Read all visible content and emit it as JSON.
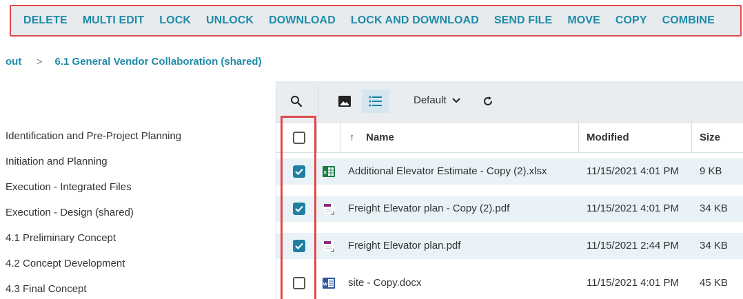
{
  "toolbar": {
    "actions": [
      "DELETE",
      "MULTI EDIT",
      "LOCK",
      "UNLOCK",
      "DOWNLOAD",
      "LOCK AND DOWNLOAD",
      "SEND FILE",
      "MOVE",
      "COPY",
      "COMBINE"
    ]
  },
  "breadcrumb": {
    "previous": "out",
    "separator": ">",
    "current": "6.1 General Vendor Collaboration (shared)"
  },
  "tree": {
    "items": [
      "Identification and Pre-Project Planning",
      "Initiation and Planning",
      "Execution - Integrated Files",
      "Execution - Design (shared)",
      "4.1 Preliminary Concept",
      "4.2 Concept Development",
      "4.3 Final Concept"
    ]
  },
  "file_toolbar": {
    "view_mode": "Default",
    "icons": [
      "search-icon",
      "image-view-icon",
      "list-view-icon",
      "chevron-down-icon",
      "refresh-icon"
    ]
  },
  "table": {
    "columns": {
      "name": "Name",
      "modified": "Modified",
      "size": "Size"
    },
    "sort_indicator": "↑",
    "rows": [
      {
        "name": "Additional Elevator Estimate - Copy (2).xlsx",
        "modified": "11/15/2021 4:01 PM",
        "size": "9 KB",
        "type": "xlsx",
        "checked": true
      },
      {
        "name": "Freight Elevator plan - Copy (2).pdf",
        "modified": "11/15/2021 4:01 PM",
        "size": "34 KB",
        "type": "pdf",
        "checked": true
      },
      {
        "name": "Freight Elevator plan.pdf",
        "modified": "11/15/2021 2:44 PM",
        "size": "34 KB",
        "type": "pdf",
        "checked": true
      },
      {
        "name": "site - Copy.docx",
        "modified": "11/15/2021 4:01 PM",
        "size": "45 KB",
        "type": "docx",
        "checked": false
      }
    ]
  },
  "colors": {
    "accent": "#1e8ba8",
    "highlight": "#e04848",
    "checkbox": "#1f7fa3",
    "selected_row": "#e8f2f7"
  }
}
